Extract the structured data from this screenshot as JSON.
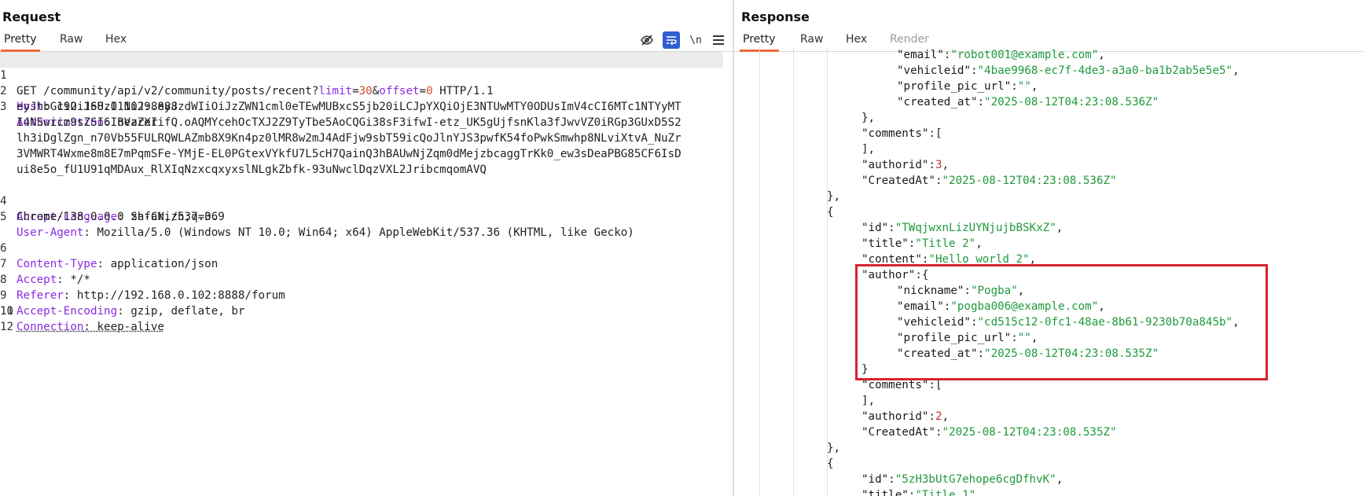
{
  "request": {
    "title": "Request",
    "tabs": [
      "Pretty",
      "Raw",
      "Hex"
    ],
    "toolbar": {
      "hide_icon": "eye-off-icon",
      "wrap_icon": "wrap-icon",
      "newline_label": "\\n",
      "menu_icon": "menu-icon"
    },
    "line_numbers": [
      "1",
      "",
      "2",
      "3",
      "",
      "",
      "",
      "",
      "",
      "4",
      "5",
      "",
      "6",
      "7",
      "8",
      "9",
      "10",
      "11",
      "12"
    ],
    "method": "GET",
    "path": " /community/api/v2/community/posts/recent?",
    "param_limit_key": "limit",
    "param_limit_val": "30",
    "param_offset_key": "offset",
    "param_offset_val": "0",
    "protocol": " HTTP/1.1",
    "headers": {
      "host_key": "Host",
      "host_val": " 192.168.0.102:8888",
      "auth_key": "Authorization",
      "auth_val": " Bearer",
      "token_lines": [
        "eyJhbGciOiJSUzI1NiJ9.eyJzdWIiOiJzZWN1cml0eTEwMUBxcS5jb20iLCJpYXQiOjE3NTUwMTY0ODUsImV4cCI6MTc1NTYyMT",
        "I4NSwicm9sZSI6InVzZXIifQ.oAQMYcehOcTXJ2Z9TyTbe5AoCQGi38sF3ifwI-etz_UK5gUjfsnKla3fJwvVZ0iRGp3GUxD5S2",
        "lh3iDglZgn_n70Vb55FULRQWLAZmb8X9Kn4pz0lMR8w2mJ4AdFjw9sbT59icQoJlnYJS3pwfK54foPwkSmwhp8NLviXtvA_NuZr",
        "3VMWRT4Wxme8m8E7mPqmSFe-YMjE-EL0PGtexVYkfU7L5cH7QainQ3hBAUwNjZqm0dMejzbcaggTrKk0_ew3sDeaPBG85CF6IsD",
        "ui8e5o_fU1U91qMDAux_RlXIqNzxcqxyxslNLgkZbfk-93uNwclDqzVXL2JribcmqomAVQ"
      ],
      "lang_key": "Accept-Language",
      "lang_val": " zh-CN,zh;q=0.9",
      "ua_key": "User-Agent",
      "ua_val": " Mozilla/5.0 (Windows NT 10.0; Win64; x64) AppleWebKit/537.36 (KHTML, like Gecko)",
      "ua_val2": "Chrome/138.0.0.0 Safari/537.36",
      "ct_key": "Content-Type",
      "ct_val": " application/json",
      "accept_key": "Accept",
      "accept_val": " */*",
      "referer_key": "Referer",
      "referer_val": " http://192.168.0.102:8888/forum",
      "enc_key": "Accept-Encoding",
      "enc_val": " gzip, deflate, br",
      "conn_key": "Connection",
      "conn_val": " keep-alive"
    }
  },
  "response": {
    "title": "Response",
    "tabs": [
      "Pretty",
      "Raw",
      "Hex",
      "Render"
    ],
    "lines": [
      {
        "indent": 4,
        "parts": [
          [
            "k",
            "\"email\""
          ],
          [
            "p",
            ":"
          ],
          [
            "s",
            "\"robot001@example.com\""
          ],
          [
            "p",
            ","
          ]
        ]
      },
      {
        "indent": 4,
        "parts": [
          [
            "k",
            "\"vehicleid\""
          ],
          [
            "p",
            ":"
          ],
          [
            "s",
            "\"4bae9968-ec7f-4de3-a3a0-ba1b2ab5e5e5\""
          ],
          [
            "p",
            ","
          ]
        ]
      },
      {
        "indent": 4,
        "parts": [
          [
            "k",
            "\"profile_pic_url\""
          ],
          [
            "p",
            ":"
          ],
          [
            "s",
            "\"\""
          ],
          [
            "p",
            ","
          ]
        ]
      },
      {
        "indent": 4,
        "parts": [
          [
            "k",
            "\"created_at\""
          ],
          [
            "p",
            ":"
          ],
          [
            "s",
            "\"2025-08-12T04:23:08.536Z\""
          ]
        ]
      },
      {
        "indent": 3,
        "parts": [
          [
            "p",
            "},"
          ]
        ]
      },
      {
        "indent": 3,
        "parts": [
          [
            "k",
            "\"comments\""
          ],
          [
            "p",
            ":["
          ]
        ]
      },
      {
        "indent": 3,
        "parts": [
          [
            "p",
            "],"
          ]
        ]
      },
      {
        "indent": 3,
        "parts": [
          [
            "k",
            "\"authorid\""
          ],
          [
            "p",
            ":"
          ],
          [
            "n",
            "3"
          ],
          [
            "p",
            ","
          ]
        ]
      },
      {
        "indent": 3,
        "parts": [
          [
            "k",
            "\"CreatedAt\""
          ],
          [
            "p",
            ":"
          ],
          [
            "s",
            "\"2025-08-12T04:23:08.536Z\""
          ]
        ]
      },
      {
        "indent": 2,
        "parts": [
          [
            "p",
            "},"
          ]
        ]
      },
      {
        "indent": 2,
        "parts": [
          [
            "p",
            "{"
          ]
        ]
      },
      {
        "indent": 3,
        "parts": [
          [
            "k",
            "\"id\""
          ],
          [
            "p",
            ":"
          ],
          [
            "s",
            "\"TWqjwxnLizUYNjujbBSKxZ\""
          ],
          [
            "p",
            ","
          ]
        ]
      },
      {
        "indent": 3,
        "parts": [
          [
            "k",
            "\"title\""
          ],
          [
            "p",
            ":"
          ],
          [
            "s",
            "\"Title 2\""
          ],
          [
            "p",
            ","
          ]
        ]
      },
      {
        "indent": 3,
        "parts": [
          [
            "k",
            "\"content\""
          ],
          [
            "p",
            ":"
          ],
          [
            "s",
            "\"Hello world 2\""
          ],
          [
            "p",
            ","
          ]
        ]
      },
      {
        "indent": 3,
        "parts": [
          [
            "k",
            "\"author\""
          ],
          [
            "p",
            ":{"
          ]
        ]
      },
      {
        "indent": 4,
        "parts": [
          [
            "k",
            "\"nickname\""
          ],
          [
            "p",
            ":"
          ],
          [
            "s",
            "\"Pogba\""
          ],
          [
            "p",
            ","
          ]
        ]
      },
      {
        "indent": 4,
        "parts": [
          [
            "k",
            "\"email\""
          ],
          [
            "p",
            ":"
          ],
          [
            "s",
            "\"pogba006@example.com\""
          ],
          [
            "p",
            ","
          ]
        ]
      },
      {
        "indent": 4,
        "parts": [
          [
            "k",
            "\"vehicleid\""
          ],
          [
            "p",
            ":"
          ],
          [
            "s",
            "\"cd515c12-0fc1-48ae-8b61-9230b70a845b\""
          ],
          [
            "p",
            ","
          ]
        ]
      },
      {
        "indent": 4,
        "parts": [
          [
            "k",
            "\"profile_pic_url\""
          ],
          [
            "p",
            ":"
          ],
          [
            "s",
            "\"\""
          ],
          [
            "p",
            ","
          ]
        ]
      },
      {
        "indent": 4,
        "parts": [
          [
            "k",
            "\"created_at\""
          ],
          [
            "p",
            ":"
          ],
          [
            "s",
            "\"2025-08-12T04:23:08.535Z\""
          ]
        ]
      },
      {
        "indent": 3,
        "parts": [
          [
            "p",
            "}"
          ]
        ]
      },
      {
        "indent": 3,
        "parts": [
          [
            "k",
            "\"comments\""
          ],
          [
            "p",
            ":["
          ]
        ]
      },
      {
        "indent": 3,
        "parts": [
          [
            "p",
            "],"
          ]
        ]
      },
      {
        "indent": 3,
        "parts": [
          [
            "k",
            "\"authorid\""
          ],
          [
            "p",
            ":"
          ],
          [
            "n",
            "2"
          ],
          [
            "p",
            ","
          ]
        ]
      },
      {
        "indent": 3,
        "parts": [
          [
            "k",
            "\"CreatedAt\""
          ],
          [
            "p",
            ":"
          ],
          [
            "s",
            "\"2025-08-12T04:23:08.535Z\""
          ]
        ]
      },
      {
        "indent": 2,
        "parts": [
          [
            "p",
            "},"
          ]
        ]
      },
      {
        "indent": 2,
        "parts": [
          [
            "p",
            "{"
          ]
        ]
      },
      {
        "indent": 3,
        "parts": [
          [
            "k",
            "\"id\""
          ],
          [
            "p",
            ":"
          ],
          [
            "s",
            "\"5zH3bUtG7ehope6cgDfhvK\""
          ],
          [
            "p",
            ","
          ]
        ]
      },
      {
        "indent": 3,
        "parts": [
          [
            "k",
            "\"title\""
          ],
          [
            "p",
            ":"
          ],
          [
            "s",
            "\"Title 1\""
          ],
          [
            "p",
            ","
          ]
        ]
      }
    ]
  }
}
